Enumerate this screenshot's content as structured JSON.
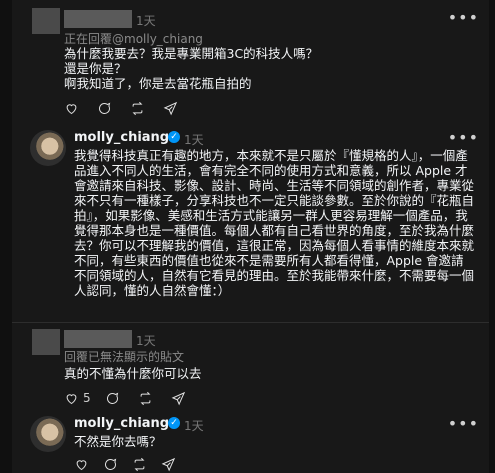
{
  "posts": [
    {
      "time": "1天",
      "reply_to": "正在回覆@molly_chiang",
      "text": "為什麼我要去？我是專業開箱3C的科技人嗎？\n還是你是？\n啊我知道了，你是去當花瓶自拍的",
      "counts": {
        "likes": "",
        "replies": "",
        "reposts": "",
        "shares": ""
      }
    },
    {
      "username": "molly_chiang",
      "time": "1天",
      "text": "我覺得科技真正有趣的地方，本來就不是只屬於『懂規格的人』，一個產品進入不同人的生活，會有完全不同的使用方式和意義，所以 Apple 才會邀請來自科技、影像、設計、時尚、生活等不同領域的創作者，專業從來不只有一種樣子，分享科技也不一定只能談參數。至於你說的『花瓶自拍』，如果影像、美感和生活方式能讓另一群人更容易理解一個產品，我覺得那本身也是一種價值。每個人都有自己看世界的角度，至於我為什麼去？你可以不理解我的價值，這很正常，因為每個人看事情的維度本來就不同，有些東西的價值也從來不是需要所有人都看得懂，Apple 會邀請不同領域的人，自然有它看見的理由。至於我能帶來什麼，不需要每一個人認同，懂的人自然會懂：）",
      "counts": {
        "likes": "",
        "replies": "",
        "reposts": "",
        "shares": ""
      }
    },
    {
      "time": "1天",
      "reply_to": "回覆已無法顯示的貼文",
      "text": "真的不懂為什麼你可以去",
      "counts": {
        "likes": "5",
        "replies": "",
        "reposts": "",
        "shares": ""
      }
    },
    {
      "username": "molly_chiang",
      "time": "1天",
      "text": "不然是你去嗎？",
      "counts": {
        "likes": "",
        "replies": "",
        "reposts": "",
        "shares": ""
      }
    }
  ],
  "icons": {
    "more": "more-icon",
    "like": "heart-icon",
    "reply": "comment-icon",
    "repost": "repost-icon",
    "share": "send-icon",
    "verified": "verified-badge-icon"
  },
  "colors": {
    "background": "#181818",
    "verified": "#0095f6",
    "muted": "#777777"
  }
}
